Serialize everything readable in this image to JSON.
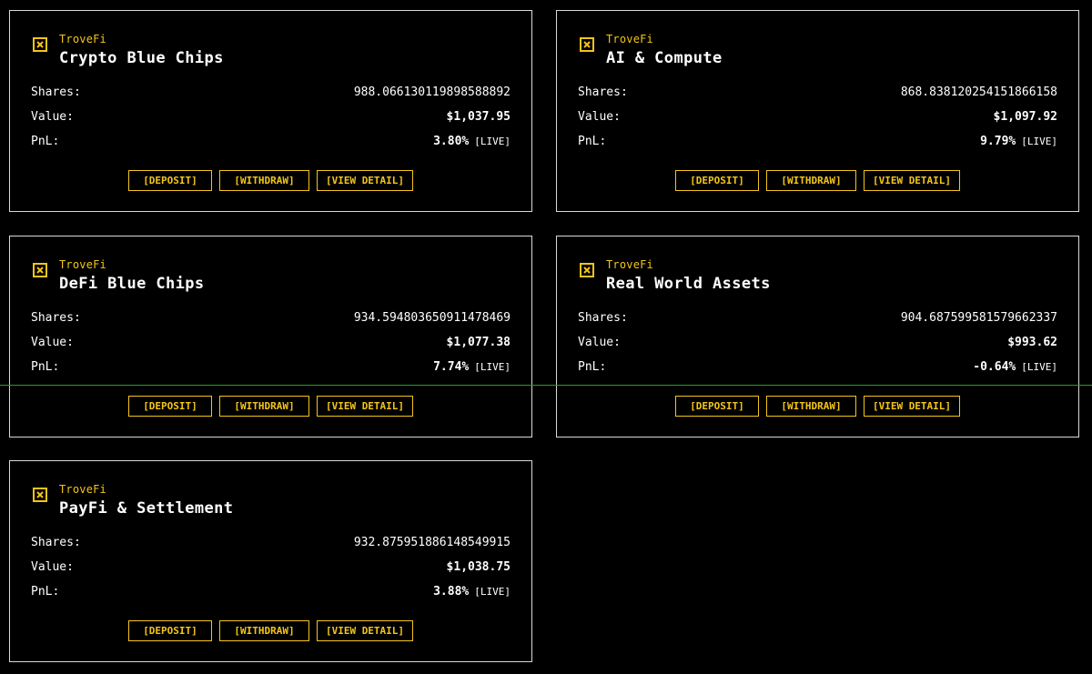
{
  "colors": {
    "accent": "#f5c518",
    "negative": "#ff3b3b",
    "border": "#d9d9d9",
    "background": "#000000"
  },
  "labels": {
    "shares": "Shares:",
    "value": "Value:",
    "pnl": "PnL:",
    "live": "[LIVE]",
    "deposit": "[DEPOSIT]",
    "withdraw": "[WITHDRAW]",
    "view_detail": "[VIEW DETAIL]"
  },
  "icon": "trovefi-x-box-icon",
  "vaults": [
    {
      "brand": "TroveFi",
      "title": "Crypto Blue Chips",
      "shares": "988.066130119898588892",
      "value": "$1,037.95",
      "pnl": "3.80%",
      "pnl_sign": "positive"
    },
    {
      "brand": "TroveFi",
      "title": "AI & Compute",
      "shares": "868.838120254151866158",
      "value": "$1,097.92",
      "pnl": "9.79%",
      "pnl_sign": "positive"
    },
    {
      "brand": "TroveFi",
      "title": "DeFi Blue Chips",
      "shares": "934.594803650911478469",
      "value": "$1,077.38",
      "pnl": "7.74%",
      "pnl_sign": "positive"
    },
    {
      "brand": "TroveFi",
      "title": "Real World Assets",
      "shares": "904.687599581579662337",
      "value": "$993.62",
      "pnl": "-0.64%",
      "pnl_sign": "negative"
    },
    {
      "brand": "TroveFi",
      "title": "PayFi & Settlement",
      "shares": "932.875951886148549915",
      "value": "$1,038.75",
      "pnl": "3.88%",
      "pnl_sign": "positive"
    }
  ]
}
